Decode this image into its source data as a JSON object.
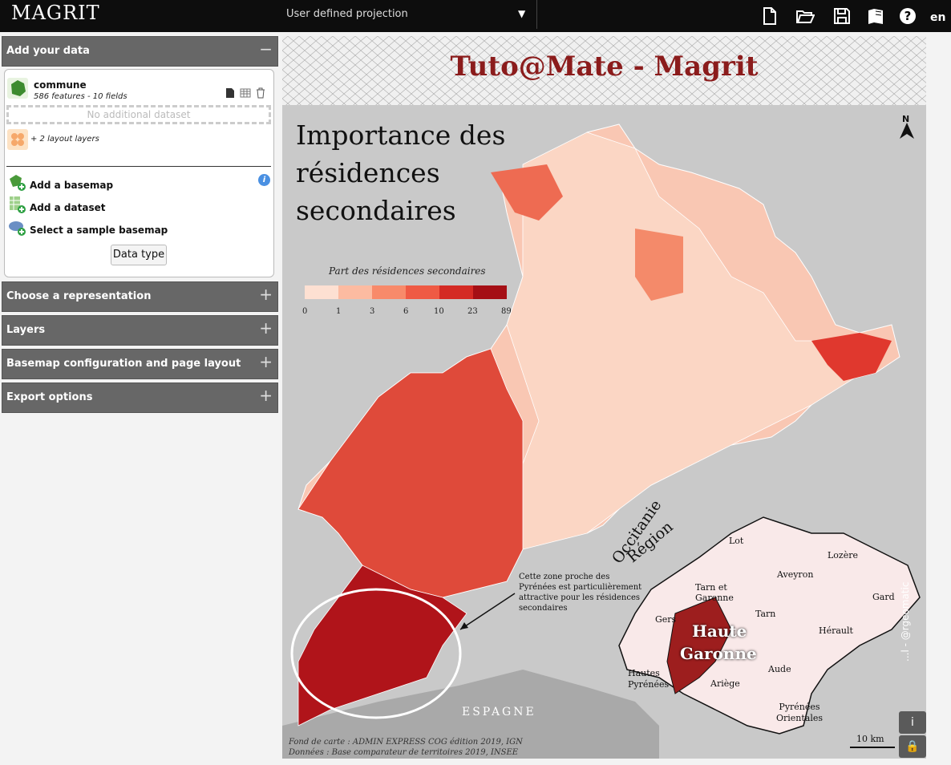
{
  "app": {
    "logo": "MAGRIT",
    "lang": "en"
  },
  "projection": {
    "label": "User defined projection"
  },
  "toolbar": {
    "icons": [
      "new-file-icon",
      "open-folder-icon",
      "save-icon",
      "documentation-icon",
      "help-icon"
    ]
  },
  "sections": {
    "add_data": "Add your data",
    "representation": "Choose a representation",
    "layers": "Layers",
    "basemap_config": "Basemap configuration and page layout",
    "export": "Export options",
    "collapse_glyph": "−",
    "expand_glyph": "+"
  },
  "dataset": {
    "name": "commune",
    "info": "586 features - 10 fields",
    "no_additional": "No additional dataset",
    "layout_layers": "+ 2 layout layers"
  },
  "actions": {
    "add_basemap": "Add a basemap",
    "add_dataset": "Add a dataset",
    "sample_basemap": "Select a sample basemap",
    "data_type": "Data type"
  },
  "map": {
    "title": "Tuto@Mate - Magrit",
    "subtitle": "Importance des résidences secondaires",
    "north": "N",
    "legend_title": "Part des résidences secondaires",
    "legend_breaks": [
      "0",
      "1",
      "3",
      "6",
      "10",
      "23",
      "89"
    ],
    "legend_colors": [
      "#fde0d2",
      "#fcbba1",
      "#f88a6a",
      "#ef5a44",
      "#d42a24",
      "#a50f15"
    ],
    "annotation": "Cette zone proche des Pyrénées est particulièrement attractive pour les résidences secondaires",
    "country": "ESPAGNE",
    "inset_title_1": "Région",
    "inset_title_2": "Occitanie",
    "departments": [
      "Lot",
      "Lozère",
      "Aveyron",
      "Tarn et Garonne",
      "Gard",
      "Gers",
      "Tarn",
      "Hérault",
      "Hautes Pyrénées",
      "Ariège",
      "Aude",
      "Pyrénées Orientales"
    ],
    "highlight_1": "Haute",
    "highlight_2": "Garonne",
    "source_1": "Fond de carte : ADMIN EXPRESS COG édition 2019, IGN",
    "source_2": "Données : Base comparateur de territoires 2019, INSEE",
    "scale": "10 km",
    "credit": "...l - @rgeomatic",
    "info_btn": "i",
    "lock_btn": "🔒"
  }
}
